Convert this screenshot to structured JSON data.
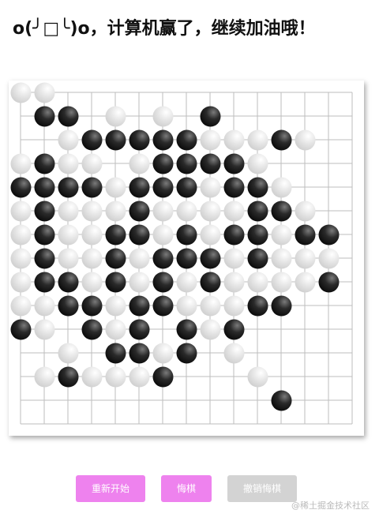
{
  "title": "o(╯□╰)o，计算机赢了，继续加油哦！",
  "board": {
    "size": 15,
    "stones": [
      {
        "row": 0,
        "col": 0,
        "color": "white"
      },
      {
        "row": 0,
        "col": 1,
        "color": "white"
      },
      {
        "row": 1,
        "col": 1,
        "color": "black"
      },
      {
        "row": 1,
        "col": 2,
        "color": "black"
      },
      {
        "row": 1,
        "col": 4,
        "color": "white"
      },
      {
        "row": 1,
        "col": 6,
        "color": "white"
      },
      {
        "row": 1,
        "col": 8,
        "color": "black"
      },
      {
        "row": 2,
        "col": 2,
        "color": "white"
      },
      {
        "row": 2,
        "col": 3,
        "color": "black"
      },
      {
        "row": 2,
        "col": 4,
        "color": "black"
      },
      {
        "row": 2,
        "col": 5,
        "color": "black"
      },
      {
        "row": 2,
        "col": 6,
        "color": "black"
      },
      {
        "row": 2,
        "col": 7,
        "color": "black"
      },
      {
        "row": 2,
        "col": 8,
        "color": "white"
      },
      {
        "row": 2,
        "col": 9,
        "color": "white"
      },
      {
        "row": 2,
        "col": 10,
        "color": "white"
      },
      {
        "row": 2,
        "col": 11,
        "color": "black"
      },
      {
        "row": 2,
        "col": 12,
        "color": "white"
      },
      {
        "row": 3,
        "col": 0,
        "color": "white"
      },
      {
        "row": 3,
        "col": 1,
        "color": "black"
      },
      {
        "row": 3,
        "col": 2,
        "color": "white"
      },
      {
        "row": 3,
        "col": 3,
        "color": "white"
      },
      {
        "row": 3,
        "col": 5,
        "color": "white"
      },
      {
        "row": 3,
        "col": 6,
        "color": "black"
      },
      {
        "row": 3,
        "col": 7,
        "color": "black"
      },
      {
        "row": 3,
        "col": 8,
        "color": "black"
      },
      {
        "row": 3,
        "col": 9,
        "color": "black"
      },
      {
        "row": 3,
        "col": 10,
        "color": "white"
      },
      {
        "row": 4,
        "col": 0,
        "color": "black"
      },
      {
        "row": 4,
        "col": 1,
        "color": "black"
      },
      {
        "row": 4,
        "col": 2,
        "color": "black"
      },
      {
        "row": 4,
        "col": 3,
        "color": "black"
      },
      {
        "row": 4,
        "col": 4,
        "color": "white"
      },
      {
        "row": 4,
        "col": 5,
        "color": "black"
      },
      {
        "row": 4,
        "col": 6,
        "color": "black"
      },
      {
        "row": 4,
        "col": 7,
        "color": "black"
      },
      {
        "row": 4,
        "col": 8,
        "color": "white"
      },
      {
        "row": 4,
        "col": 9,
        "color": "black"
      },
      {
        "row": 4,
        "col": 10,
        "color": "black"
      },
      {
        "row": 4,
        "col": 11,
        "color": "white"
      },
      {
        "row": 5,
        "col": 0,
        "color": "white"
      },
      {
        "row": 5,
        "col": 1,
        "color": "black"
      },
      {
        "row": 5,
        "col": 2,
        "color": "white"
      },
      {
        "row": 5,
        "col": 3,
        "color": "white"
      },
      {
        "row": 5,
        "col": 4,
        "color": "white"
      },
      {
        "row": 5,
        "col": 5,
        "color": "black"
      },
      {
        "row": 5,
        "col": 6,
        "color": "white"
      },
      {
        "row": 5,
        "col": 7,
        "color": "white"
      },
      {
        "row": 5,
        "col": 8,
        "color": "white"
      },
      {
        "row": 5,
        "col": 9,
        "color": "white"
      },
      {
        "row": 5,
        "col": 10,
        "color": "black"
      },
      {
        "row": 5,
        "col": 11,
        "color": "black"
      },
      {
        "row": 5,
        "col": 12,
        "color": "white"
      },
      {
        "row": 6,
        "col": 0,
        "color": "white"
      },
      {
        "row": 6,
        "col": 1,
        "color": "black"
      },
      {
        "row": 6,
        "col": 2,
        "color": "white"
      },
      {
        "row": 6,
        "col": 3,
        "color": "white"
      },
      {
        "row": 6,
        "col": 4,
        "color": "black"
      },
      {
        "row": 6,
        "col": 5,
        "color": "black"
      },
      {
        "row": 6,
        "col": 6,
        "color": "white"
      },
      {
        "row": 6,
        "col": 7,
        "color": "black"
      },
      {
        "row": 6,
        "col": 8,
        "color": "white"
      },
      {
        "row": 6,
        "col": 9,
        "color": "black"
      },
      {
        "row": 6,
        "col": 10,
        "color": "black"
      },
      {
        "row": 6,
        "col": 11,
        "color": "white"
      },
      {
        "row": 6,
        "col": 12,
        "color": "black"
      },
      {
        "row": 6,
        "col": 13,
        "color": "black"
      },
      {
        "row": 7,
        "col": 0,
        "color": "white"
      },
      {
        "row": 7,
        "col": 1,
        "color": "black"
      },
      {
        "row": 7,
        "col": 2,
        "color": "white"
      },
      {
        "row": 7,
        "col": 3,
        "color": "white"
      },
      {
        "row": 7,
        "col": 4,
        "color": "black"
      },
      {
        "row": 7,
        "col": 5,
        "color": "white"
      },
      {
        "row": 7,
        "col": 6,
        "color": "black"
      },
      {
        "row": 7,
        "col": 7,
        "color": "black"
      },
      {
        "row": 7,
        "col": 8,
        "color": "black"
      },
      {
        "row": 7,
        "col": 9,
        "color": "white"
      },
      {
        "row": 7,
        "col": 10,
        "color": "black"
      },
      {
        "row": 7,
        "col": 11,
        "color": "white"
      },
      {
        "row": 7,
        "col": 12,
        "color": "white"
      },
      {
        "row": 7,
        "col": 13,
        "color": "white"
      },
      {
        "row": 8,
        "col": 0,
        "color": "white"
      },
      {
        "row": 8,
        "col": 1,
        "color": "black"
      },
      {
        "row": 8,
        "col": 2,
        "color": "black"
      },
      {
        "row": 8,
        "col": 3,
        "color": "white"
      },
      {
        "row": 8,
        "col": 4,
        "color": "black"
      },
      {
        "row": 8,
        "col": 5,
        "color": "white"
      },
      {
        "row": 8,
        "col": 6,
        "color": "black"
      },
      {
        "row": 8,
        "col": 7,
        "color": "white"
      },
      {
        "row": 8,
        "col": 8,
        "color": "black"
      },
      {
        "row": 8,
        "col": 9,
        "color": "white"
      },
      {
        "row": 8,
        "col": 10,
        "color": "white"
      },
      {
        "row": 8,
        "col": 11,
        "color": "white"
      },
      {
        "row": 8,
        "col": 12,
        "color": "white"
      },
      {
        "row": 8,
        "col": 13,
        "color": "black"
      },
      {
        "row": 9,
        "col": 0,
        "color": "white"
      },
      {
        "row": 9,
        "col": 1,
        "color": "white"
      },
      {
        "row": 9,
        "col": 2,
        "color": "black"
      },
      {
        "row": 9,
        "col": 3,
        "color": "black"
      },
      {
        "row": 9,
        "col": 4,
        "color": "white"
      },
      {
        "row": 9,
        "col": 5,
        "color": "black"
      },
      {
        "row": 9,
        "col": 6,
        "color": "black"
      },
      {
        "row": 9,
        "col": 7,
        "color": "white"
      },
      {
        "row": 9,
        "col": 8,
        "color": "white"
      },
      {
        "row": 9,
        "col": 9,
        "color": "white"
      },
      {
        "row": 9,
        "col": 10,
        "color": "black"
      },
      {
        "row": 9,
        "col": 11,
        "color": "black"
      },
      {
        "row": 10,
        "col": 0,
        "color": "black"
      },
      {
        "row": 10,
        "col": 1,
        "color": "white"
      },
      {
        "row": 10,
        "col": 3,
        "color": "black"
      },
      {
        "row": 10,
        "col": 4,
        "color": "white"
      },
      {
        "row": 10,
        "col": 5,
        "color": "black"
      },
      {
        "row": 10,
        "col": 7,
        "color": "black"
      },
      {
        "row": 10,
        "col": 8,
        "color": "white"
      },
      {
        "row": 10,
        "col": 9,
        "color": "black"
      },
      {
        "row": 11,
        "col": 2,
        "color": "white"
      },
      {
        "row": 11,
        "col": 4,
        "color": "black"
      },
      {
        "row": 11,
        "col": 5,
        "color": "black"
      },
      {
        "row": 11,
        "col": 6,
        "color": "white"
      },
      {
        "row": 11,
        "col": 7,
        "color": "black"
      },
      {
        "row": 11,
        "col": 9,
        "color": "white"
      },
      {
        "row": 12,
        "col": 1,
        "color": "white"
      },
      {
        "row": 12,
        "col": 2,
        "color": "black"
      },
      {
        "row": 12,
        "col": 3,
        "color": "white"
      },
      {
        "row": 12,
        "col": 4,
        "color": "white"
      },
      {
        "row": 12,
        "col": 5,
        "color": "white"
      },
      {
        "row": 12,
        "col": 6,
        "color": "black"
      },
      {
        "row": 12,
        "col": 10,
        "color": "white"
      },
      {
        "row": 13,
        "col": 11,
        "color": "black"
      }
    ]
  },
  "buttons": {
    "restart": "重新开始",
    "undo": "悔棋",
    "cancel_undo": "撤销悔棋"
  },
  "colors": {
    "button_active": "#ee82ee",
    "button_disabled": "#d3d3d3",
    "grid_line": "#bdbdbd"
  },
  "watermark": "@稀土掘金技术社区"
}
